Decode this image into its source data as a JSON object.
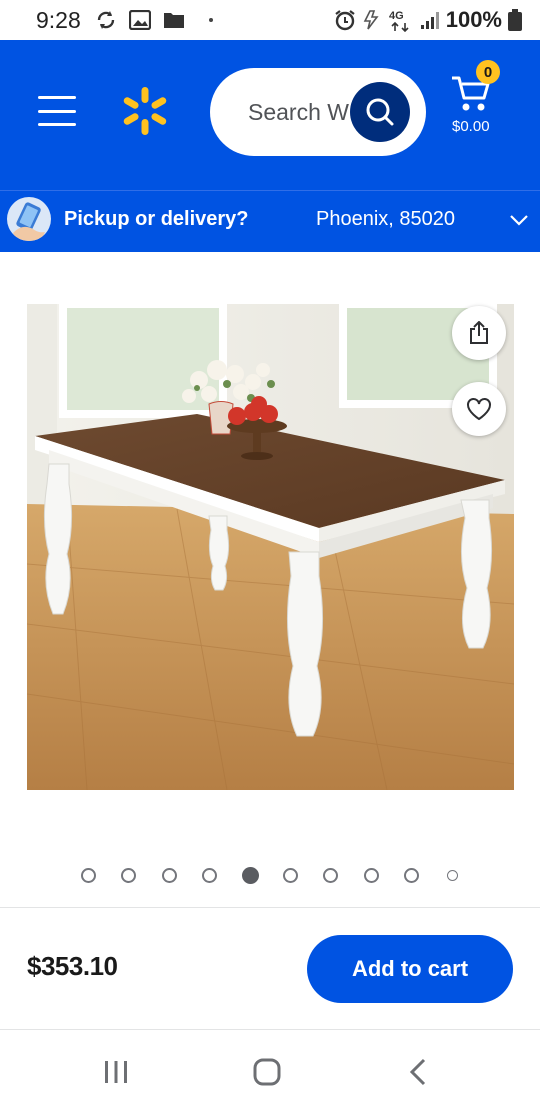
{
  "status_bar": {
    "time": "9:28",
    "battery_text": "100%",
    "network_label": "4G",
    "icons": [
      "sync-icon",
      "gallery-icon",
      "folder-icon",
      "alarm-icon",
      "data-saver-icon",
      "4g-icon",
      "signal-icon",
      "battery-icon"
    ]
  },
  "header": {
    "search_placeholder": "Search W",
    "cart_count": "0",
    "cart_total": "$0.00",
    "brand_color": "#0053e2",
    "spark_color": "#ffc220",
    "search_button_color": "#002d7c"
  },
  "pickup": {
    "label": "Pickup or delivery?",
    "location": "Phoenix, 85020"
  },
  "product": {
    "image_description_icon": "dining-table-photo",
    "price": "$353.10",
    "add_to_cart_label": "Add to cart"
  },
  "carousel": {
    "count": 10,
    "active_index": 4
  },
  "navigation_bar": {
    "icons": [
      "recent-apps-icon",
      "home-icon",
      "back-icon"
    ]
  }
}
